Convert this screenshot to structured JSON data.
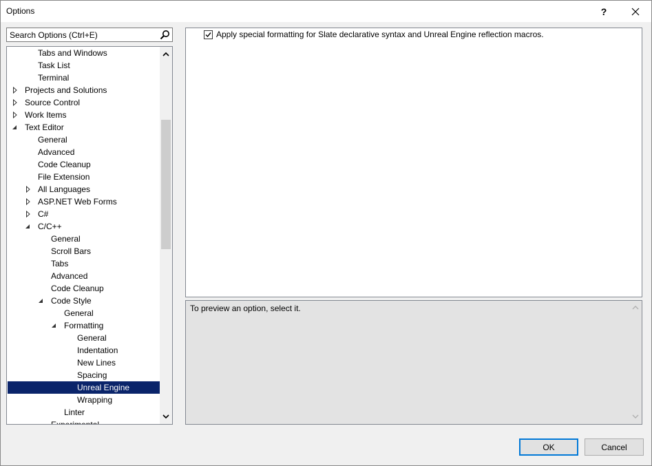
{
  "window": {
    "title": "Options",
    "help_label": "?",
    "close_label": "✕"
  },
  "search": {
    "placeholder": "Search Options (Ctrl+E)"
  },
  "tree": {
    "items": [
      {
        "label": "Tabs and Windows",
        "level": 2,
        "arrow": "none"
      },
      {
        "label": "Task List",
        "level": 2,
        "arrow": "none"
      },
      {
        "label": "Terminal",
        "level": 2,
        "arrow": "none"
      },
      {
        "label": "Projects and Solutions",
        "level": 1,
        "arrow": "collapsed"
      },
      {
        "label": "Source Control",
        "level": 1,
        "arrow": "collapsed"
      },
      {
        "label": "Work Items",
        "level": 1,
        "arrow": "collapsed"
      },
      {
        "label": "Text Editor",
        "level": 1,
        "arrow": "expanded"
      },
      {
        "label": "General",
        "level": 2,
        "arrow": "none"
      },
      {
        "label": "Advanced",
        "level": 2,
        "arrow": "none"
      },
      {
        "label": "Code Cleanup",
        "level": 2,
        "arrow": "none"
      },
      {
        "label": "File Extension",
        "level": 2,
        "arrow": "none"
      },
      {
        "label": "All Languages",
        "level": 2,
        "arrow": "collapsed"
      },
      {
        "label": "ASP.NET Web Forms",
        "level": 2,
        "arrow": "collapsed"
      },
      {
        "label": "C#",
        "level": 2,
        "arrow": "collapsed"
      },
      {
        "label": "C/C++",
        "level": 2,
        "arrow": "expanded"
      },
      {
        "label": "General",
        "level": 3,
        "arrow": "none"
      },
      {
        "label": "Scroll Bars",
        "level": 3,
        "arrow": "none"
      },
      {
        "label": "Tabs",
        "level": 3,
        "arrow": "none"
      },
      {
        "label": "Advanced",
        "level": 3,
        "arrow": "none"
      },
      {
        "label": "Code Cleanup",
        "level": 3,
        "arrow": "none"
      },
      {
        "label": "Code Style",
        "level": 3,
        "arrow": "expanded"
      },
      {
        "label": "General",
        "level": 4,
        "arrow": "none"
      },
      {
        "label": "Formatting",
        "level": 4,
        "arrow": "expanded"
      },
      {
        "label": "General",
        "level": 5,
        "arrow": "none"
      },
      {
        "label": "Indentation",
        "level": 5,
        "arrow": "none"
      },
      {
        "label": "New Lines",
        "level": 5,
        "arrow": "none"
      },
      {
        "label": "Spacing",
        "level": 5,
        "arrow": "none"
      },
      {
        "label": "Unreal Engine",
        "level": 5,
        "arrow": "none",
        "selected": true
      },
      {
        "label": "Wrapping",
        "level": 5,
        "arrow": "none"
      },
      {
        "label": "Linter",
        "level": 4,
        "arrow": "none"
      },
      {
        "label": "Experimental",
        "level": 3,
        "arrow": "none"
      }
    ]
  },
  "options": {
    "checkbox_label": "Apply special formatting for Slate declarative syntax and Unreal Engine reflection macros.",
    "checked": true
  },
  "preview": {
    "text": "To preview an option, select it."
  },
  "buttons": {
    "ok_label": "OK",
    "cancel_label": "Cancel"
  },
  "colors": {
    "selection": "#0a246a",
    "accent": "#0078d7"
  }
}
